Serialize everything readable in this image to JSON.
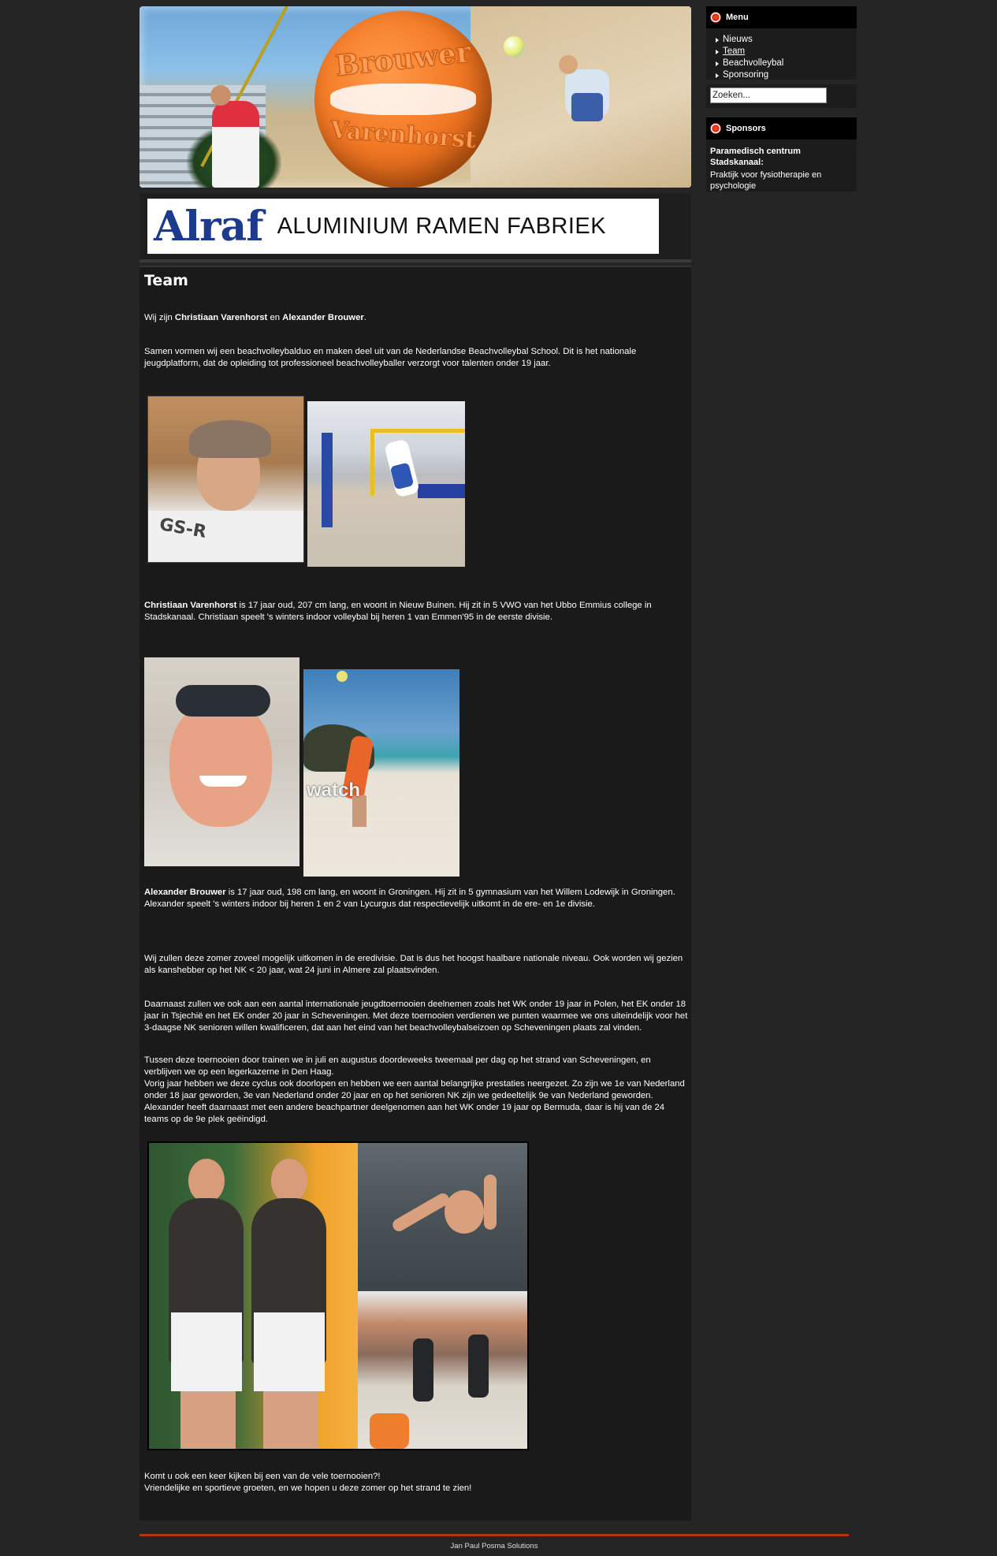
{
  "banner": {
    "ball_text_top": "Brouwer",
    "ball_text_bottom": "Varenhorst"
  },
  "ad": {
    "logo": "Alraf",
    "text": "ALUMINIUM RAMEN FABRIEK"
  },
  "sidebar": {
    "menu_title": "Menu",
    "menu_items": [
      {
        "label": "Nieuws"
      },
      {
        "label": "Team"
      },
      {
        "label": "Beachvolleybal"
      },
      {
        "label": "Sponsoring"
      }
    ],
    "search_value": "Zoeken...",
    "sponsors_title": "Sponsors",
    "sponsor_name": "Paramedisch centrum Stadskanaal:",
    "sponsor_desc": "Praktijk voor fysiotherapie en psychologie"
  },
  "content": {
    "title": "Team",
    "intro_a": "Wij zijn ",
    "intro_b": "Christiaan Varenhorst",
    "intro_c": " en ",
    "intro_d": "Alexander Brouwer",
    "intro_e": ".",
    "p_samen": "Samen vormen wij een beachvolleybalduo en maken deel uit van de Nederlandse Beachvolleybal School. Dit is het nationale jeugdplatform, dat de opleiding tot professioneel beachvolleyballer verzorgt voor talenten onder 19 jaar.",
    "christiaan_name": "Christiaan Varenhorst",
    "christiaan_text": " is 17 jaar oud, 207 cm lang, en woont in Nieuw Buinen. Hij zit in 5 VWO van het Ubbo Emmius college in Stadskanaal.  Christiaan speelt 's winters indoor volleybal bij heren 1 van Emmen'95 in de eerste divisie.",
    "christiaan_shirt": "GS-R",
    "alexander_name": "Alexander Brouwer",
    "alexander_text": " is 17 jaar oud, 198 cm lang, en woont in Groningen. Hij zit in 5 gymnasium van het Willem Lodewijk in Groningen.  Alexander speelt 's winters indoor bij heren 1 en 2 van Lycurgus dat respectievelijk uitkomt in de ere- en 1e divisie.",
    "alexander_photo_text": "watch",
    "p_eredivisie": "Wij zullen deze zomer zoveel mogelijk uitkomen in de eredivisie. Dat is dus het hoogst haalbare nationale niveau. Ook worden wij gezien als kanshebber op het NK < 20 jaar, wat 24 juni in Almere zal plaatsvinden.",
    "p_internationaal": "Daarnaast zullen we ook aan een aantal internationale jeugdtoernooien deelnemen zoals het WK onder 19 jaar in Polen, het EK onder 18 jaar in Tsjechië en het EK onder 20 jaar in Scheveningen. Met deze toernooien verdienen we punten waarmee we ons uiteindelijk voor het 3-daagse NK senioren willen kwalificeren, dat aan het eind van het beachvolleybalseizoen op Scheveningen plaats zal vinden.",
    "p_trainen": "Tussen deze toernooien door trainen we in juli en augustus doordeweeks tweemaal per dag op het strand van Scheveningen, en verblijven we op een legerkazerne in Den Haag.",
    "p_vorig": "Vorig jaar hebben we deze cyclus ook doorlopen en hebben we een aantal belangrijke prestaties neergezet. Zo zijn we 1e van Nederland onder 18 jaar geworden, 3e van Nederland onder 20 jaar en op het senioren NK zijn we gedeeltelijk 9e van Nederland geworden. Alexander heeft daarnaast met een andere beachpartner deelgenomen aan het WK onder 19 jaar op Bermuda, daar is hij van de 24 teams op de 9e plek geëindigd.",
    "p_komt": "Komt u ook een keer kijken bij een van de vele toernooien?!",
    "p_groeten": "Vriendelijke en sportieve groeten, en we hopen u deze zomer op het strand te zien!"
  },
  "footer": {
    "credit": "Jan Paul Posma Solutions"
  }
}
